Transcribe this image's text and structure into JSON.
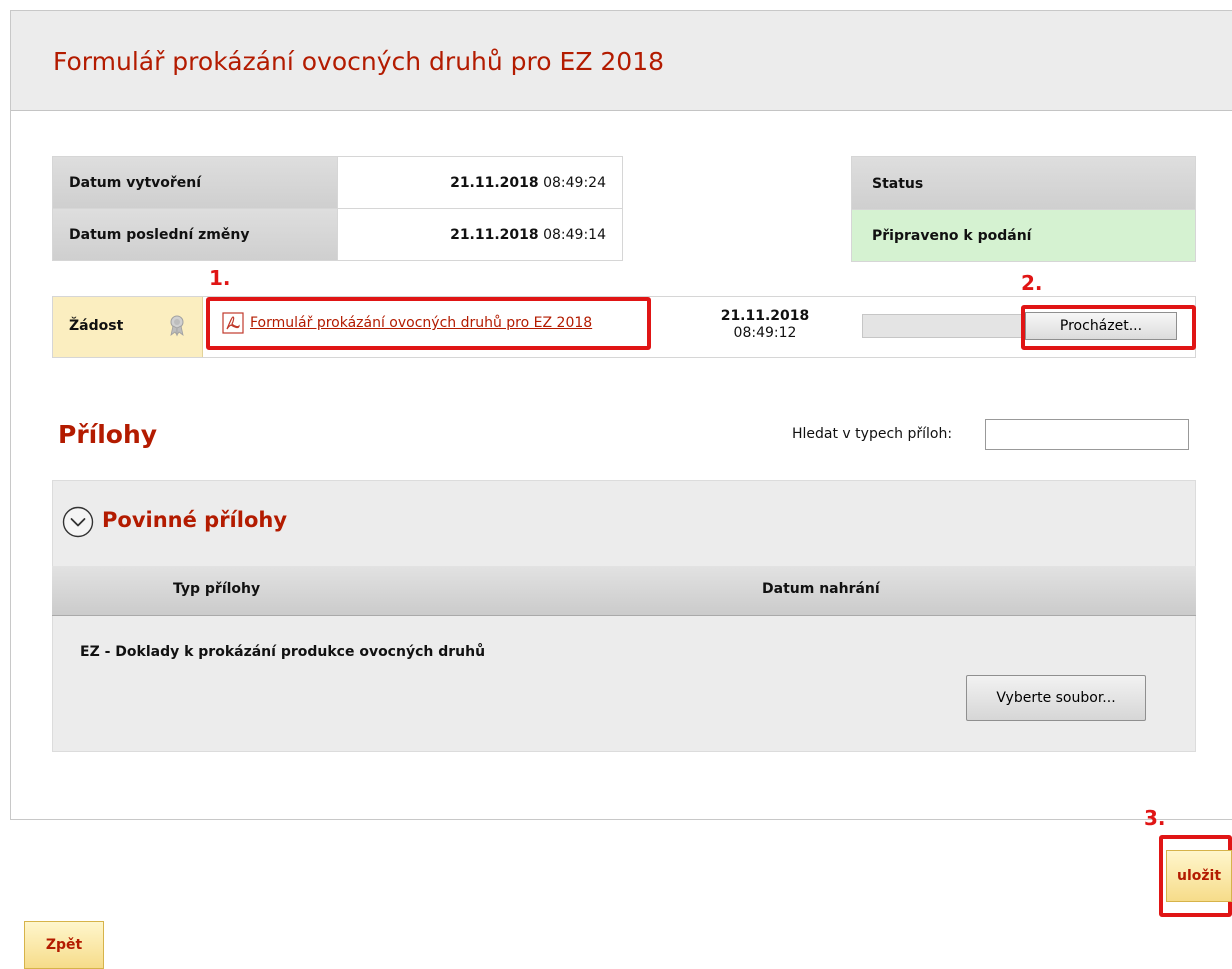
{
  "form": {
    "title": "Formulář prokázání ovocných druhů pro EZ 2018"
  },
  "info": {
    "created_label": "Datum vytvoření",
    "created_date": "21.11.2018",
    "created_time": "08:49:24",
    "modified_label": "Datum poslední změny",
    "modified_date": "21.11.2018",
    "modified_time": "08:49:14",
    "status_label": "Status",
    "status_value": "Připraveno k podání",
    "status_color": "#d5f2d1"
  },
  "zadost": {
    "label": "Žádost",
    "link_text": "Formulář prokázání ovocných druhů pro EZ 2018",
    "date": "21.11.2018",
    "time": "08:49:12",
    "browse_label": "Procházet..."
  },
  "annotations": {
    "step1": "1.",
    "step2": "2.",
    "step3": "3.",
    "color": "#e01515"
  },
  "prilohy": {
    "title": "Přílohy",
    "search_label": "Hledat v typech příloh:",
    "search_value": "",
    "section_title": "Povinné přílohy",
    "columns": [
      "Typ přílohy",
      "Datum nahrání"
    ],
    "rows": [
      {
        "type": "EZ - Doklady k prokázání produkce ovocných druhů",
        "uploaded": ""
      }
    ],
    "select_file_label": "Vyberte soubor..."
  },
  "actions": {
    "save_label": "uložit",
    "back_label": "Zpět"
  },
  "theme": {
    "accent": "#b31b00",
    "header_bg": "#ececec",
    "button_yellow": "#f6dc8a"
  }
}
